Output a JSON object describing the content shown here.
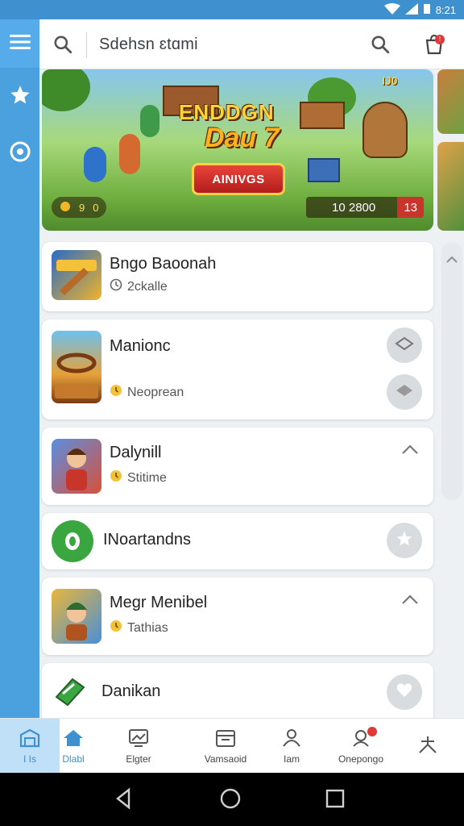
{
  "status_bar": {
    "time": "8:21"
  },
  "search": {
    "placeholder": "Sdehsn ɛtɑmi"
  },
  "banner": {
    "title_line1": "ENDDGN",
    "title_line2": "Dau 7",
    "cta_label": "AINIVGS",
    "coin_left": "9",
    "coin_right": "0",
    "score": "10  2800",
    "score_tag": "13",
    "badge": "IJ0"
  },
  "list": [
    {
      "title": "Bngo Baoonah",
      "subtitle": "2ckalle",
      "sub_icon": "clock-icon",
      "action": "none"
    },
    {
      "title": "Manionc",
      "subtitle": "Neoprean",
      "sub_icon": "timer-icon",
      "action": "diamond-buttons"
    },
    {
      "title": "Dalynill",
      "subtitle": "Stitime",
      "sub_icon": "timer-icon",
      "action": "chevron-up"
    },
    {
      "title": "INoartandns",
      "subtitle": "",
      "sub_icon": "",
      "action": "star-button"
    },
    {
      "title": "Megr Menibel",
      "subtitle": "Tathias",
      "sub_icon": "timer-icon",
      "action": "chevron-up"
    },
    {
      "title": "Danikan",
      "subtitle": "",
      "sub_icon": "",
      "action": "heart-button"
    }
  ],
  "bottom_nav": [
    {
      "label": "I Is",
      "icon": "store-icon"
    },
    {
      "label": "Dlabl",
      "icon": "home-icon"
    },
    {
      "label": "Elgter",
      "icon": "gallery-icon"
    },
    {
      "label": "Vamsaoid",
      "icon": "calendar-icon"
    },
    {
      "label": "Iam",
      "icon": "people-icon"
    },
    {
      "label": "Onepongo",
      "icon": "chat-icon"
    },
    {
      "label": "",
      "icon": "person-icon"
    }
  ],
  "colors": {
    "accent": "#3e90cf",
    "rail": "#4ba1de",
    "badge": "#e0393a"
  }
}
